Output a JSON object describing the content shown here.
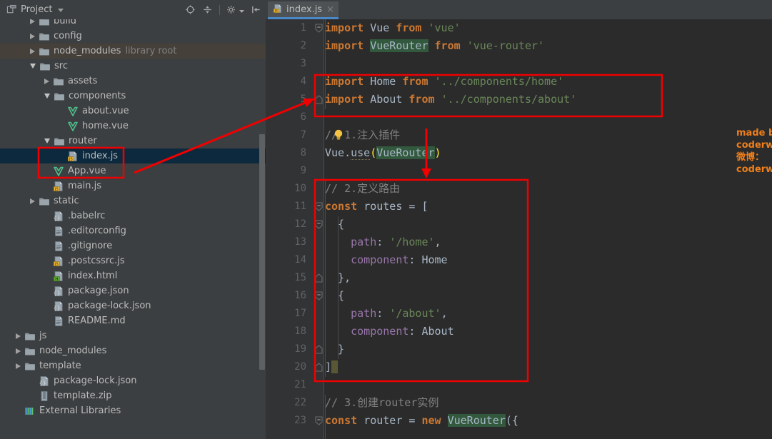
{
  "project_panel": {
    "title": "Project",
    "toolbar_icons": [
      {
        "name": "locate-target-icon"
      },
      {
        "name": "collapse-all-icon"
      },
      {
        "name": "settings-gear-icon"
      },
      {
        "name": "hide-panel-icon"
      }
    ],
    "tree": [
      {
        "label": "build",
        "type": "folder",
        "indent": 1,
        "arrow": "right",
        "state": "normal"
      },
      {
        "label": "config",
        "type": "folder",
        "indent": 1,
        "arrow": "right",
        "state": "normal"
      },
      {
        "label": "node_modules",
        "type": "folder",
        "indent": 1,
        "arrow": "right",
        "state": "libroot",
        "sub": "library root"
      },
      {
        "label": "src",
        "type": "folder",
        "indent": 1,
        "arrow": "down",
        "state": "normal"
      },
      {
        "label": "assets",
        "type": "folder",
        "indent": 2,
        "arrow": "right",
        "state": "normal"
      },
      {
        "label": "components",
        "type": "folder",
        "indent": 2,
        "arrow": "down",
        "state": "normal"
      },
      {
        "label": "about.vue",
        "type": "vue",
        "indent": 3,
        "arrow": "none",
        "state": "normal"
      },
      {
        "label": "home.vue",
        "type": "vue",
        "indent": 3,
        "arrow": "none",
        "state": "normal"
      },
      {
        "label": "router",
        "type": "folder",
        "indent": 2,
        "arrow": "down",
        "state": "normal"
      },
      {
        "label": "index.js",
        "type": "js",
        "indent": 3,
        "arrow": "none",
        "state": "selected"
      },
      {
        "label": "App.vue",
        "type": "vue",
        "indent": 2,
        "arrow": "none",
        "state": "normal"
      },
      {
        "label": "main.js",
        "type": "js",
        "indent": 2,
        "arrow": "none",
        "state": "normal"
      },
      {
        "label": "static",
        "type": "folder",
        "indent": 1,
        "arrow": "right",
        "state": "normal"
      },
      {
        "label": ".babelrc",
        "type": "json",
        "indent": 2,
        "arrow": "none",
        "state": "normal"
      },
      {
        "label": ".editorconfig",
        "type": "text",
        "indent": 2,
        "arrow": "none",
        "state": "normal"
      },
      {
        "label": ".gitignore",
        "type": "text",
        "indent": 2,
        "arrow": "none",
        "state": "normal"
      },
      {
        "label": ".postcssrc.js",
        "type": "js",
        "indent": 2,
        "arrow": "none",
        "state": "normal"
      },
      {
        "label": "index.html",
        "type": "html",
        "indent": 2,
        "arrow": "none",
        "state": "normal"
      },
      {
        "label": "package.json",
        "type": "json",
        "indent": 2,
        "arrow": "none",
        "state": "normal"
      },
      {
        "label": "package-lock.json",
        "type": "json",
        "indent": 2,
        "arrow": "none",
        "state": "normal"
      },
      {
        "label": "README.md",
        "type": "text",
        "indent": 2,
        "arrow": "none",
        "state": "normal"
      },
      {
        "label": "js",
        "type": "folder",
        "indent": 0,
        "arrow": "right",
        "state": "normal"
      },
      {
        "label": "node_modules",
        "type": "folder",
        "indent": 0,
        "arrow": "right",
        "state": "normal"
      },
      {
        "label": "template",
        "type": "folder",
        "indent": 0,
        "arrow": "right",
        "state": "normal"
      },
      {
        "label": "package-lock.json",
        "type": "json",
        "indent": 1,
        "arrow": "none",
        "state": "normal"
      },
      {
        "label": "template.zip",
        "type": "zip",
        "indent": 1,
        "arrow": "none",
        "state": "normal"
      },
      {
        "label": "External Libraries",
        "type": "libs",
        "indent": 0,
        "arrow": "none",
        "state": "normal"
      }
    ]
  },
  "editor": {
    "tab": {
      "label": "index.js",
      "icon": "js-file-icon",
      "close": "×"
    },
    "line_numbers": [
      "1",
      "2",
      "3",
      "4",
      "5",
      "6",
      "7",
      "8",
      "9",
      "10",
      "11",
      "12",
      "13",
      "14",
      "15",
      "16",
      "17",
      "18",
      "19",
      "20",
      "21",
      "22",
      "23"
    ],
    "code_lines": [
      "import Vue from 'vue'",
      "import VueRouter from 'vue-router'",
      "",
      "import Home from '../components/home'",
      "import About from '../components/about'",
      "",
      "// 1.注入插件",
      "Vue.use(VueRouter)",
      "",
      "// 2.定义路由",
      "const routes = [",
      "  {",
      "    path: '/home',",
      "    component: Home",
      "  },",
      "  {",
      "    path: '/about',",
      "    component: About",
      "  }",
      "]",
      "",
      "// 3.创建router实例",
      "const router = new VueRouter({"
    ],
    "tokens": {
      "kw_import": "import",
      "kw_from": "from",
      "kw_const": "const",
      "kw_new": "new",
      "id_vue": "Vue",
      "id_vuerouter": "VueRouter",
      "id_home": "Home",
      "id_about": "About",
      "id_routes": "routes",
      "id_router": "router",
      "id_use": "use",
      "str_vue": "'vue'",
      "str_vue_router": "'vue-router'",
      "str_home_path": "'../components/home'",
      "str_about_path": "'../components/about'",
      "str_home_route": "'/home'",
      "str_about_route": "'/about'",
      "prop_path": "path",
      "prop_component": "component",
      "cmt_inject": "// 1.注入插件",
      "cmt_routes": "// 2.定义路由",
      "cmt_instance": "// 3.创建router实例"
    },
    "watermark": {
      "line1": "made by coderwhy",
      "line2": "微博： coderwhy",
      "color": "#ef7f1a"
    },
    "inspection_icon": "lightbulb-icon"
  },
  "annotations": {
    "color": "#f00000",
    "boxes": [
      {
        "name": "router-index-highlight-box"
      },
      {
        "name": "imports-highlight-box"
      },
      {
        "name": "routes-definition-highlight-box"
      }
    ],
    "arrows": [
      {
        "name": "sidebar-to-imports-arrow"
      },
      {
        "name": "plugin-to-routes-arrow"
      }
    ]
  },
  "colors": {
    "panel_bg": "#3c3f41",
    "editor_bg": "#2b2b2b",
    "gutter_bg": "#313335",
    "selection": "#0d293e",
    "library_root": "#45403a",
    "tab_active_underline": "#4a88c7",
    "keyword": "#cc7832",
    "string": "#6a8759",
    "property": "#9876aa",
    "comment": "#808080",
    "identifier": "#a9b7c6"
  }
}
